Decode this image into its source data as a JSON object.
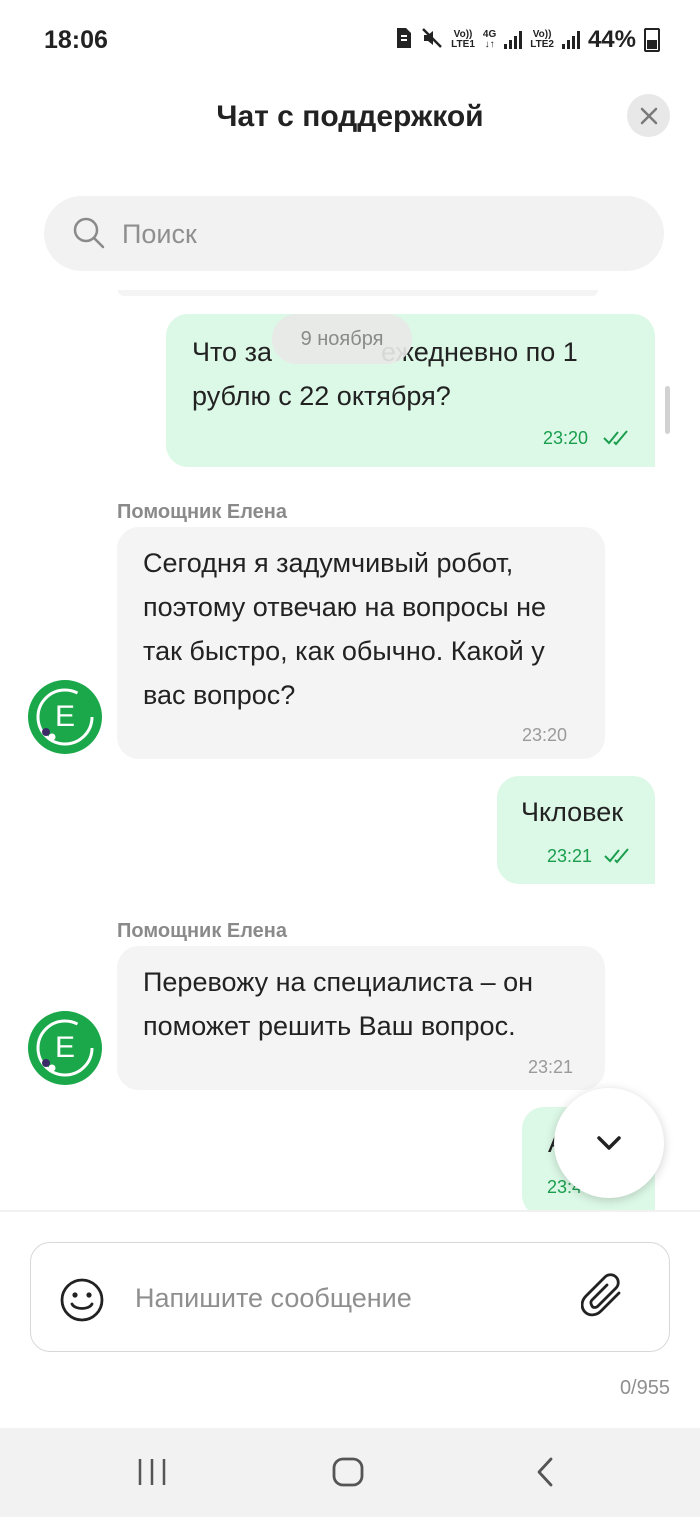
{
  "status_bar": {
    "time": "18:06",
    "sim1_top": "Vo))",
    "sim1_bottom": "LTE1",
    "net_top": "4G",
    "net_bottom": "↓↑",
    "sim2_top": "Vo))",
    "sim2_bottom": "LTE2",
    "battery": "44%"
  },
  "header": {
    "title": "Чат с поддержкой"
  },
  "search": {
    "placeholder": "Поиск"
  },
  "chat": {
    "date_chip": "9 ноября",
    "messages": [
      {
        "direction": "out",
        "text_line1": "Что за",
        "text_line1_rest": "ежедневно по 1",
        "text_line2": "рублю с 22 октября?",
        "time": "23:20"
      },
      {
        "direction": "in",
        "sender": "Помощник Елена",
        "lines": [
          "Сегодня я задумчивый робот,",
          "поэтому отвечаю на вопросы не",
          "так быстро, как обычно. Какой у",
          "вас вопрос?"
        ],
        "time": "23:20"
      },
      {
        "direction": "out",
        "text": "Чкловек",
        "time": "23:21"
      },
      {
        "direction": "in",
        "sender": "Помощник Елена",
        "lines": [
          "Перевожу на специалиста – он",
          "поможет решить Ваш вопрос."
        ],
        "time": "23:21"
      },
      {
        "direction": "out",
        "text": "А",
        "time": "23:4"
      }
    ],
    "avatar_letter": "E"
  },
  "composer": {
    "placeholder": "Напишите сообщение",
    "counter": "0/955"
  },
  "colors": {
    "accent": "#1aa84a",
    "outgoing_bubble": "#dcf8e6",
    "incoming_bubble": "#f4f4f4",
    "time_green": "#1a9e4e"
  },
  "icons": [
    "search-icon",
    "close-icon",
    "double-check-icon",
    "chevron-down-icon",
    "emoji-icon",
    "paperclip-icon",
    "recent-apps-icon",
    "home-icon",
    "back-icon"
  ]
}
